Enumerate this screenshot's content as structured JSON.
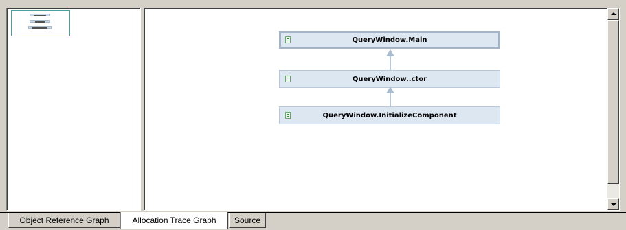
{
  "overview": {
    "nodes": [
      "QueryWindow.Main",
      "QueryWindow..ctor",
      "QueryWindow.InitializeComponent"
    ]
  },
  "graph": {
    "nodes": [
      {
        "label": "QueryWindow.Main",
        "selected": true,
        "icon": "method-icon"
      },
      {
        "label": "QueryWindow..ctor",
        "selected": false,
        "icon": "method-icon"
      },
      {
        "label": "QueryWindow.InitializeComponent",
        "selected": false,
        "icon": "method-icon"
      }
    ],
    "colors": {
      "node_fill": "#dde7f2",
      "node_border": "#b8c8da",
      "edge": "#a9bbcf",
      "overview_border": "#45a0a0"
    }
  },
  "tabs": [
    {
      "label": "Object Reference Graph",
      "active": false
    },
    {
      "label": "Allocation Trace Graph",
      "active": true
    },
    {
      "label": "Source",
      "active": false
    }
  ],
  "scrollbar": {
    "position_fraction": 0.0
  }
}
